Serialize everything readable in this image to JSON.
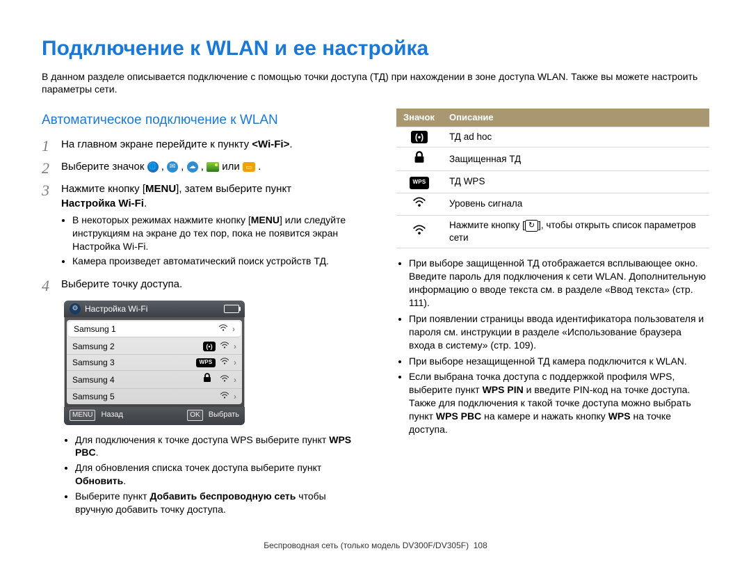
{
  "title": "Подключение к WLAN и ее настройка",
  "intro": "В данном разделе описывается подключение с помощью точки доступа (ТД) при нахождении в зоне доступа WLAN. Также вы можете настроить параметры сети.",
  "section_heading": "Автоматическое подключение к WLAN",
  "steps": {
    "s1": {
      "num": "1",
      "pre": "На главном экране перейдите к пункту ",
      "bold": "<Wi-Fi>",
      "post": "."
    },
    "s2": {
      "num": "2",
      "pre": "Выберите значок ",
      "gap": " , ",
      "or": " или ",
      "post": " ."
    },
    "s3": {
      "num": "3",
      "line_a_pre": "Нажмите кнопку [",
      "menu_label": "MENU",
      "line_a_post": "], затем выберите пункт ",
      "bold": "Настройка Wi-Fi",
      "dot": ".",
      "b1_pre": "В некоторых режимах нажмите кнопку [",
      "b1_post": "] или следуйте инструкциям на экране до тех пор, пока не появится экран Настройка Wi-Fi.",
      "b2": "Камера произведет автоматический поиск устройств ТД."
    },
    "s4": {
      "num": "4",
      "text": "Выберите точку доступа."
    }
  },
  "wifi_panel": {
    "title": "Настройка Wi-Fi",
    "items": [
      {
        "name": "Samsung 1",
        "middle": "",
        "signal": true
      },
      {
        "name": "Samsung 2",
        "middle": "adhoc",
        "signal": true
      },
      {
        "name": "Samsung 3",
        "middle": "wps",
        "signal": true
      },
      {
        "name": "Samsung 4",
        "middle": "lock",
        "signal": true
      },
      {
        "name": "Samsung 5",
        "middle": "",
        "signal": true
      }
    ],
    "footer_menu_key": "MENU",
    "footer_back": "Назад",
    "footer_ok_key": "OK",
    "footer_select": "Выбрать"
  },
  "left_bullets": {
    "b1_pre": "Для подключения к точке доступа WPS выберите пункт ",
    "b1_bold": "WPS PBC",
    "b1_post": ".",
    "b2_pre": "Для обновления списка точек доступа выберите пункт ",
    "b2_bold": "Обновить",
    "b2_post": ".",
    "b3_pre": "Выберите пункт  ",
    "b3_bold": "Добавить беспроводную сеть",
    "b3_post": " чтобы вручную добавить точку доступа."
  },
  "icon_table": {
    "h1": "Значок",
    "h2": "Описание",
    "r1": "ТД ad hoc",
    "r2": "Защищенная ТД",
    "r3": "ТД WPS",
    "r4": "Уровень сигнала",
    "r5_pre": "Нажмите кнопку [",
    "r5_key": "↻",
    "r5_post": "], чтобы открыть список параметров сети"
  },
  "right_bullets": [
    "При выборе защищенной ТД отображается всплывающее окно. Введите пароль для подключения к сети WLAN. Дополнительную информацию о вводе текста см. в разделе «Ввод текста» (стр. 111).",
    "При появлении страницы ввода идентификатора пользователя и пароля см. инструкции в разделе «Использование браузера входа в систему» (стр. 109).",
    "При выборе незащищенной ТД камера подключится к WLAN."
  ],
  "right_last": {
    "pre": "Если выбрана точка доступа с поддержкой профиля WPS, выберите пункт ",
    "wpspin": "WPS PIN",
    "mid": " и введите PIN-код на точке доступа. Также для подключения к такой точке доступа можно выбрать пункт ",
    "wpspbc": "WPS PBC",
    "mid2": " на камере и нажать кнопку ",
    "wps": "WPS",
    "post": " на точке доступа."
  },
  "footer_text": "Беспроводная сеть  (только модель DV300F/DV305F)",
  "page_num": "108",
  "chart_data": null
}
